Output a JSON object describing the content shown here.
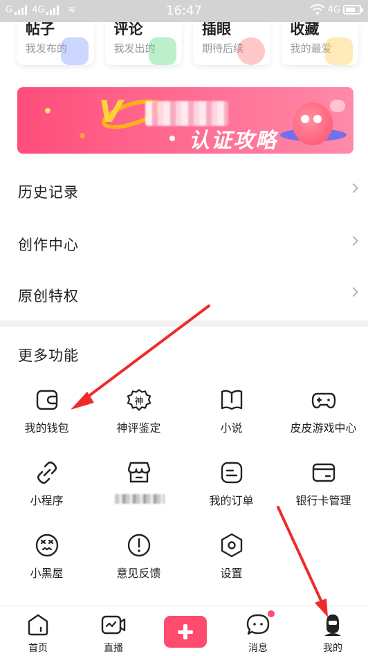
{
  "status_bar": {
    "carrier_left": "G",
    "network_left": "4G",
    "time": "16:47",
    "network_right": "4G"
  },
  "top_cards": [
    {
      "title": "帖子",
      "subtitle": "我发布的",
      "color": "#6a8dff"
    },
    {
      "title": "评论",
      "subtitle": "我发出的",
      "color": "#3dd36a"
    },
    {
      "title": "插眼",
      "subtitle": "期待后续",
      "color": "#ff6161"
    },
    {
      "title": "收藏",
      "subtitle": "我的最爱",
      "color": "#ffc531"
    }
  ],
  "banner": {
    "text": "认证攻略"
  },
  "menu_rows": [
    {
      "label": "历史记录"
    },
    {
      "label": "创作中心"
    },
    {
      "label": "原创特权"
    }
  ],
  "more_features": {
    "title": "更多功能",
    "items": [
      {
        "label": "我的钱包",
        "icon": "wallet-icon"
      },
      {
        "label": "神评鉴定",
        "icon": "shen-badge-icon",
        "glyph": "神"
      },
      {
        "label": "小说",
        "icon": "book-icon"
      },
      {
        "label": "皮皮游戏中心",
        "icon": "gamepad-icon"
      },
      {
        "label": "小程序",
        "icon": "link-icon"
      },
      {
        "label": "",
        "icon": "store-icon",
        "blurred": true
      },
      {
        "label": "我的订单",
        "icon": "order-icon"
      },
      {
        "label": "银行卡管理",
        "icon": "card-icon"
      },
      {
        "label": "小黑屋",
        "icon": "dizzy-face-icon"
      },
      {
        "label": "意见反馈",
        "icon": "feedback-icon"
      },
      {
        "label": "设置",
        "icon": "settings-hex-icon"
      }
    ]
  },
  "bottom_nav": [
    {
      "label": "首页",
      "icon": "home-icon"
    },
    {
      "label": "直播",
      "icon": "live-icon"
    },
    {
      "label": "",
      "icon": "plus-icon"
    },
    {
      "label": "消息",
      "icon": "message-icon"
    },
    {
      "label": "我的",
      "icon": "profile-icon"
    }
  ],
  "colors": {
    "accent": "#ff4b6e",
    "annotation_arrow": "#ee2b2b"
  }
}
